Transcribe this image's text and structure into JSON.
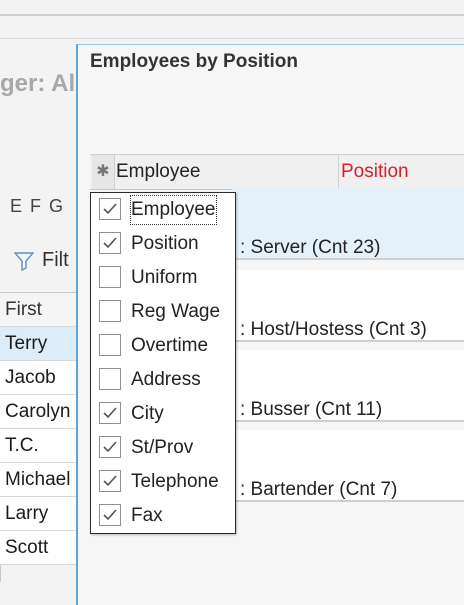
{
  "background": {
    "manager_label": "ger: Alc",
    "letters": [
      "E",
      "F",
      "G"
    ],
    "filter_label": "Filt",
    "grid": {
      "header": "First",
      "rows": [
        "Terry",
        "Jacob",
        "Carolyn",
        "T.C.",
        "Michael",
        "Larry",
        "Scott"
      ],
      "selected_index": 0
    }
  },
  "dialog": {
    "title": "Employees by Position",
    "columns": {
      "chooser_icon": "asterisk-icon",
      "employee": "Employee",
      "position": "Position"
    },
    "groups": [
      {
        "label": ": Server (Cnt  23)",
        "selected": true
      },
      {
        "label": ": Host/Hostess (Cnt  3)",
        "selected": false
      },
      {
        "label": ": Busser (Cnt  11)",
        "selected": false
      },
      {
        "label": ": Bartender (Cnt  7)",
        "selected": false
      }
    ]
  },
  "column_chooser": {
    "items": [
      {
        "label": "Employee",
        "checked": true
      },
      {
        "label": "Position",
        "checked": true
      },
      {
        "label": "Uniform",
        "checked": false
      },
      {
        "label": "Reg Wage",
        "checked": false
      },
      {
        "label": "Overtime",
        "checked": false
      },
      {
        "label": "Address",
        "checked": false
      },
      {
        "label": "City",
        "checked": true
      },
      {
        "label": "St/Prov",
        "checked": true
      },
      {
        "label": "Telephone",
        "checked": true
      },
      {
        "label": "Fax",
        "checked": true
      }
    ],
    "focused_index": 0
  },
  "colors": {
    "position_header": "#e31b1b",
    "selected_band": "#e4f1fb",
    "dialog_border": "#5ea3d9"
  }
}
